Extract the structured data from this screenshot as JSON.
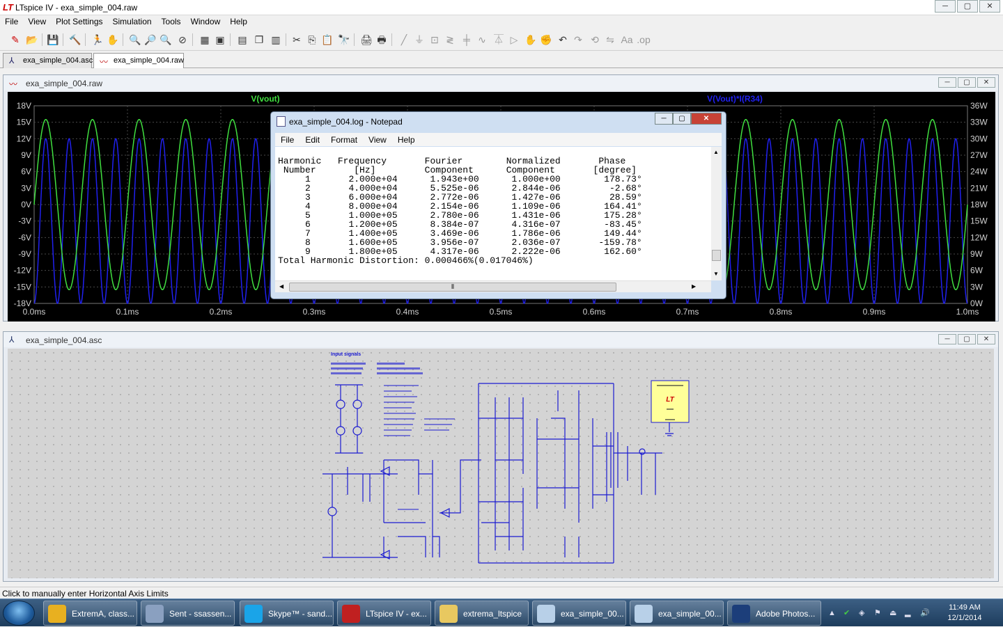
{
  "app": {
    "title": "LTspice IV - exa_simple_004.raw",
    "window_controls": [
      "─",
      "▢",
      "✕"
    ]
  },
  "menu": [
    "File",
    "View",
    "Plot Settings",
    "Simulation",
    "Tools",
    "Window",
    "Help"
  ],
  "doc_tabs": [
    {
      "label": "exa_simple_004.asc",
      "icon": "schematic-icon"
    },
    {
      "label": "exa_simple_004.raw",
      "icon": "waveform-icon"
    }
  ],
  "plot_window": {
    "title": "exa_simple_004.raw",
    "trace_left_label": "V(vout)",
    "trace_right_label": "V(Vout)*I(R34)",
    "colors": {
      "green": "#40e040",
      "blue": "#2020f0",
      "grid": "#4a4a4a"
    }
  },
  "chart_data": {
    "type": "line",
    "x_tick_labels": [
      "0.0ms",
      "0.1ms",
      "0.2ms",
      "0.3ms",
      "0.4ms",
      "0.5ms",
      "0.6ms",
      "0.7ms",
      "0.8ms",
      "0.9ms",
      "1.0ms"
    ],
    "xlim": [
      0,
      1.0
    ],
    "y_left_tick_labels": [
      "18V",
      "15V",
      "12V",
      "9V",
      "6V",
      "3V",
      "0V",
      "-3V",
      "-6V",
      "-9V",
      "-12V",
      "-15V",
      "-18V"
    ],
    "ylim_left": [
      -18,
      18
    ],
    "y_right_tick_labels": [
      "36W",
      "33W",
      "30W",
      "27W",
      "24W",
      "21W",
      "18W",
      "15W",
      "12W",
      "9W",
      "6W",
      "3W",
      "0W"
    ],
    "ylim_right": [
      0,
      36
    ],
    "series": [
      {
        "name": "V(vout)",
        "axis": "left",
        "frequency_hz": 20000,
        "amplitude": 15.5,
        "offset": 0,
        "color": "#40e040"
      },
      {
        "name": "V(Vout)*I(R34)",
        "axis": "right",
        "frequency_hz": 40000,
        "amplitude": 15.0,
        "offset": 15.0,
        "color": "#2020f0"
      }
    ]
  },
  "notepad": {
    "title": "exa_simple_004.log - Notepad",
    "menu": [
      "File",
      "Edit",
      "Format",
      "View",
      "Help"
    ],
    "header1": [
      "Harmonic",
      "Frequency",
      "Fourier",
      "Normalized",
      "Phase"
    ],
    "header2": [
      "Number",
      "[Hz]",
      "Component",
      "Component",
      "[degree]"
    ],
    "rows": [
      [
        "1",
        "2.000e+04",
        "1.943e+00",
        "1.000e+00",
        "178.73°"
      ],
      [
        "2",
        "4.000e+04",
        "5.525e-06",
        "2.844e-06",
        "-2.68°"
      ],
      [
        "3",
        "6.000e+04",
        "2.772e-06",
        "1.427e-06",
        "28.59°"
      ],
      [
        "4",
        "8.000e+04",
        "2.154e-06",
        "1.109e-06",
        "164.41°"
      ],
      [
        "5",
        "1.000e+05",
        "2.780e-06",
        "1.431e-06",
        "175.28°"
      ],
      [
        "6",
        "1.200e+05",
        "8.384e-07",
        "4.316e-07",
        "-83.45°"
      ],
      [
        "7",
        "1.400e+05",
        "3.469e-06",
        "1.786e-06",
        "149.44°"
      ],
      [
        "8",
        "1.600e+05",
        "3.956e-07",
        "2.036e-07",
        "-159.78°"
      ],
      [
        "9",
        "1.800e+05",
        "4.317e-06",
        "2.222e-06",
        "162.60°"
      ]
    ],
    "thd": "Total Harmonic Distortion: 0.000466%(0.017046%)"
  },
  "schematic_window": {
    "title": "exa_simple_004.asc",
    "input_signals_label": "Input signals"
  },
  "status_text": "Click to manually enter Horizontal Axis Limits",
  "taskbar": {
    "buttons": [
      {
        "label": "ExtremA, class...",
        "color": "#e8b020"
      },
      {
        "label": "Sent - ssassen...",
        "color": "#8aa0c0"
      },
      {
        "label": "Skype™ - sand...",
        "color": "#1aa4e8"
      },
      {
        "label": "LTspice IV - ex...",
        "color": "#c02020"
      },
      {
        "label": "extrema_ltspice",
        "color": "#e8c860"
      },
      {
        "label": "exa_simple_00...",
        "color": "#b8d0e8"
      },
      {
        "label": "exa_simple_00...",
        "color": "#b8d0e8"
      },
      {
        "label": "Adobe Photos...",
        "color": "#1c3e7a"
      }
    ],
    "time": "11:49 AM",
    "date": "12/1/2014"
  }
}
